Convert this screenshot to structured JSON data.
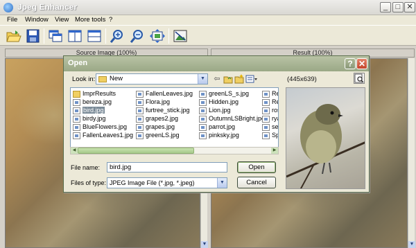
{
  "window": {
    "title": "Jpeg Enhancer",
    "min_glyph": "_",
    "max_glyph": "□",
    "close_glyph": "✕"
  },
  "menu": [
    "File",
    "Window",
    "View",
    "More tools",
    "?"
  ],
  "toolbar": {
    "buttons": [
      "open-folder-icon",
      "save-icon",
      "cascade-windows-icon",
      "tile-vertical-icon",
      "tile-horizontal-icon",
      "zoom-in-icon",
      "zoom-out-icon",
      "fit-to-window-icon",
      "enhance-image-icon"
    ]
  },
  "panels": {
    "source_header": "Source Image (100%)",
    "result_header": "Result (100%)"
  },
  "dialog": {
    "title": "Open",
    "help_glyph": "?",
    "close_glyph": "✕",
    "look_in_label": "Look in:",
    "look_in_value": "New",
    "image_dimensions": "(445x639)",
    "file_name_label": "File name:",
    "file_name_value": "bird.jpg",
    "files_of_type_label": "Files of type:",
    "files_of_type_value": "JPEG Image File (*.jpg, *.jpeg)",
    "open_button": "Open",
    "cancel_button": "Cancel",
    "columns": [
      [
        {
          "name": "ImprResults",
          "type": "folder"
        },
        {
          "name": "bereza.jpg",
          "type": "file"
        },
        {
          "name": "bird.jpg",
          "type": "file",
          "selected": true
        },
        {
          "name": "birdy.jpg",
          "type": "file"
        },
        {
          "name": "BlueFlowers.jpg",
          "type": "file"
        },
        {
          "name": "FallenLeaves1.jpg",
          "type": "file"
        }
      ],
      [
        {
          "name": "FallenLeaves.jpg",
          "type": "file"
        },
        {
          "name": "Flora.jpg",
          "type": "file"
        },
        {
          "name": "furtree_stick.jpg",
          "type": "file"
        },
        {
          "name": "grapes2.jpg",
          "type": "file"
        },
        {
          "name": "grapes.jpg",
          "type": "file"
        },
        {
          "name": "greenLS.jpg",
          "type": "file"
        }
      ],
      [
        {
          "name": "greenLS_s.jpg",
          "type": "file"
        },
        {
          "name": "Hidden.jpg",
          "type": "file"
        },
        {
          "name": "Lion.jpg",
          "type": "file"
        },
        {
          "name": "OutumnLSBright.jpg",
          "type": "file"
        },
        {
          "name": "parrot.jpg",
          "type": "file"
        },
        {
          "name": "pinksky.jpg",
          "type": "file"
        }
      ],
      [
        {
          "name": "Re",
          "type": "file"
        },
        {
          "name": "Re",
          "type": "file"
        },
        {
          "name": "ros",
          "type": "file"
        },
        {
          "name": "rya",
          "type": "file"
        },
        {
          "name": "sea",
          "type": "file"
        },
        {
          "name": "Spr",
          "type": "file"
        }
      ]
    ]
  }
}
